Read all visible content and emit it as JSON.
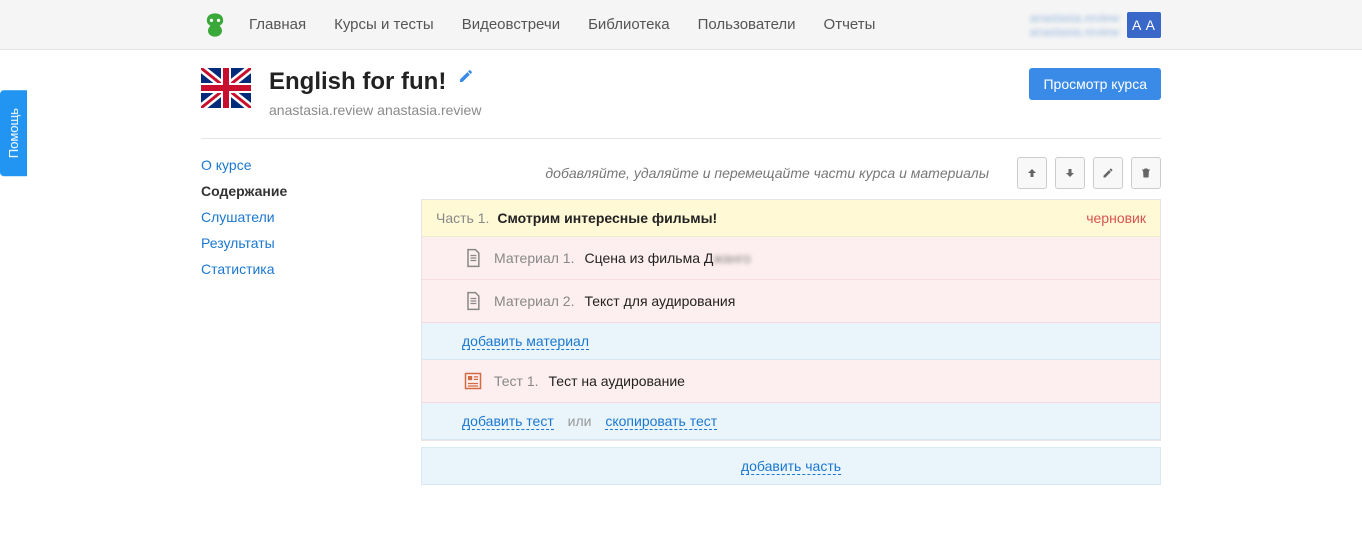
{
  "nav": {
    "items": [
      "Главная",
      "Курсы и тесты",
      "Видеовстречи",
      "Библиотека",
      "Пользователи",
      "Отчеты"
    ],
    "user_line1": "anastasia.review",
    "user_line2": "anastasia.review",
    "user_badge": "A A"
  },
  "help_tab": "Помощь",
  "course": {
    "title": "English for fun!",
    "subtitle": "anastasia.review anastasia.review",
    "view_button": "Просмотр курса"
  },
  "sidebar": {
    "items": [
      {
        "label": "О курсе",
        "active": false
      },
      {
        "label": "Содержание",
        "active": true
      },
      {
        "label": "Слушатели",
        "active": false
      },
      {
        "label": "Результаты",
        "active": false
      },
      {
        "label": "Статистика",
        "active": false
      }
    ]
  },
  "content": {
    "hint": "добавляйте, удаляйте и перемещайте части курса и материалы",
    "part_label": "Часть 1.",
    "part_title": "Смотрим интересные фильмы!",
    "part_status": "черновик",
    "materials": [
      {
        "label": "Материал 1.",
        "title": "Сцена из фильма Д",
        "blurred_tail": "жанго"
      },
      {
        "label": "Материал 2.",
        "title": "Текст для аудирования",
        "blurred_tail": ""
      }
    ],
    "add_material": "добавить материал",
    "tests": [
      {
        "label": "Тест 1.",
        "title": "Тест на аудирование"
      }
    ],
    "add_test": "добавить тест",
    "or": "или",
    "copy_test": "скопировать тест",
    "add_part": "добавить часть"
  }
}
